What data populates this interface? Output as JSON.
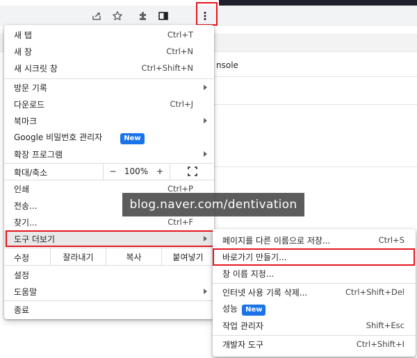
{
  "main_menu": {
    "items": [
      {
        "label": "새 탭",
        "shortcut": "Ctrl+T"
      },
      {
        "label": "새 창",
        "shortcut": "Ctrl+N"
      },
      {
        "label": "새 시크릿 창",
        "shortcut": "Ctrl+Shift+N"
      },
      {
        "label": "방문 기록"
      },
      {
        "label": "다운로드",
        "shortcut": "Ctrl+J"
      },
      {
        "label": "북마크"
      },
      {
        "label": "Google 비밀번호 관리자",
        "badge": "New"
      },
      {
        "label": "확장 프로그램"
      },
      {
        "label": "인쇄",
        "shortcut": "Ctrl+P"
      },
      {
        "label": "전송..."
      },
      {
        "label": "찾기...",
        "shortcut": "Ctrl+F"
      },
      {
        "label": "도구 더보기"
      },
      {
        "label": "설정"
      },
      {
        "label": "도움말"
      },
      {
        "label": "종료"
      }
    ],
    "zoom": {
      "label": "확대/축소",
      "minus": "−",
      "value": "100%",
      "plus": "+"
    },
    "edit": {
      "label": "수정",
      "cut": "잘라내기",
      "copy": "복사",
      "paste": "붙여넣기"
    }
  },
  "sub_menu": {
    "items": [
      {
        "label": "페이지를 다른 이름으로 저장...",
        "shortcut": "Ctrl+S"
      },
      {
        "label": "바로가기 만들기..."
      },
      {
        "label": "창 이름 지정..."
      },
      {
        "label": "인터넷 사용 기록 삭제...",
        "shortcut": "Ctrl+Shift+Del"
      },
      {
        "label": "성능",
        "badge": "New"
      },
      {
        "label": "작업 관리자",
        "shortcut": "Shift+Esc"
      },
      {
        "label": "개발자 도구",
        "shortcut": "Ctrl+Shift+I"
      }
    ]
  },
  "background": {
    "console_text": "nsole"
  },
  "watermark": "blog.naver.com/dentivation",
  "colors": {
    "highlight": "#e5141d",
    "badge": "#1a73e8"
  },
  "icons": [
    "share-icon",
    "star-icon",
    "extensions-icon",
    "side-panel-icon",
    "kebab-menu-icon",
    "fullscreen-icon"
  ]
}
